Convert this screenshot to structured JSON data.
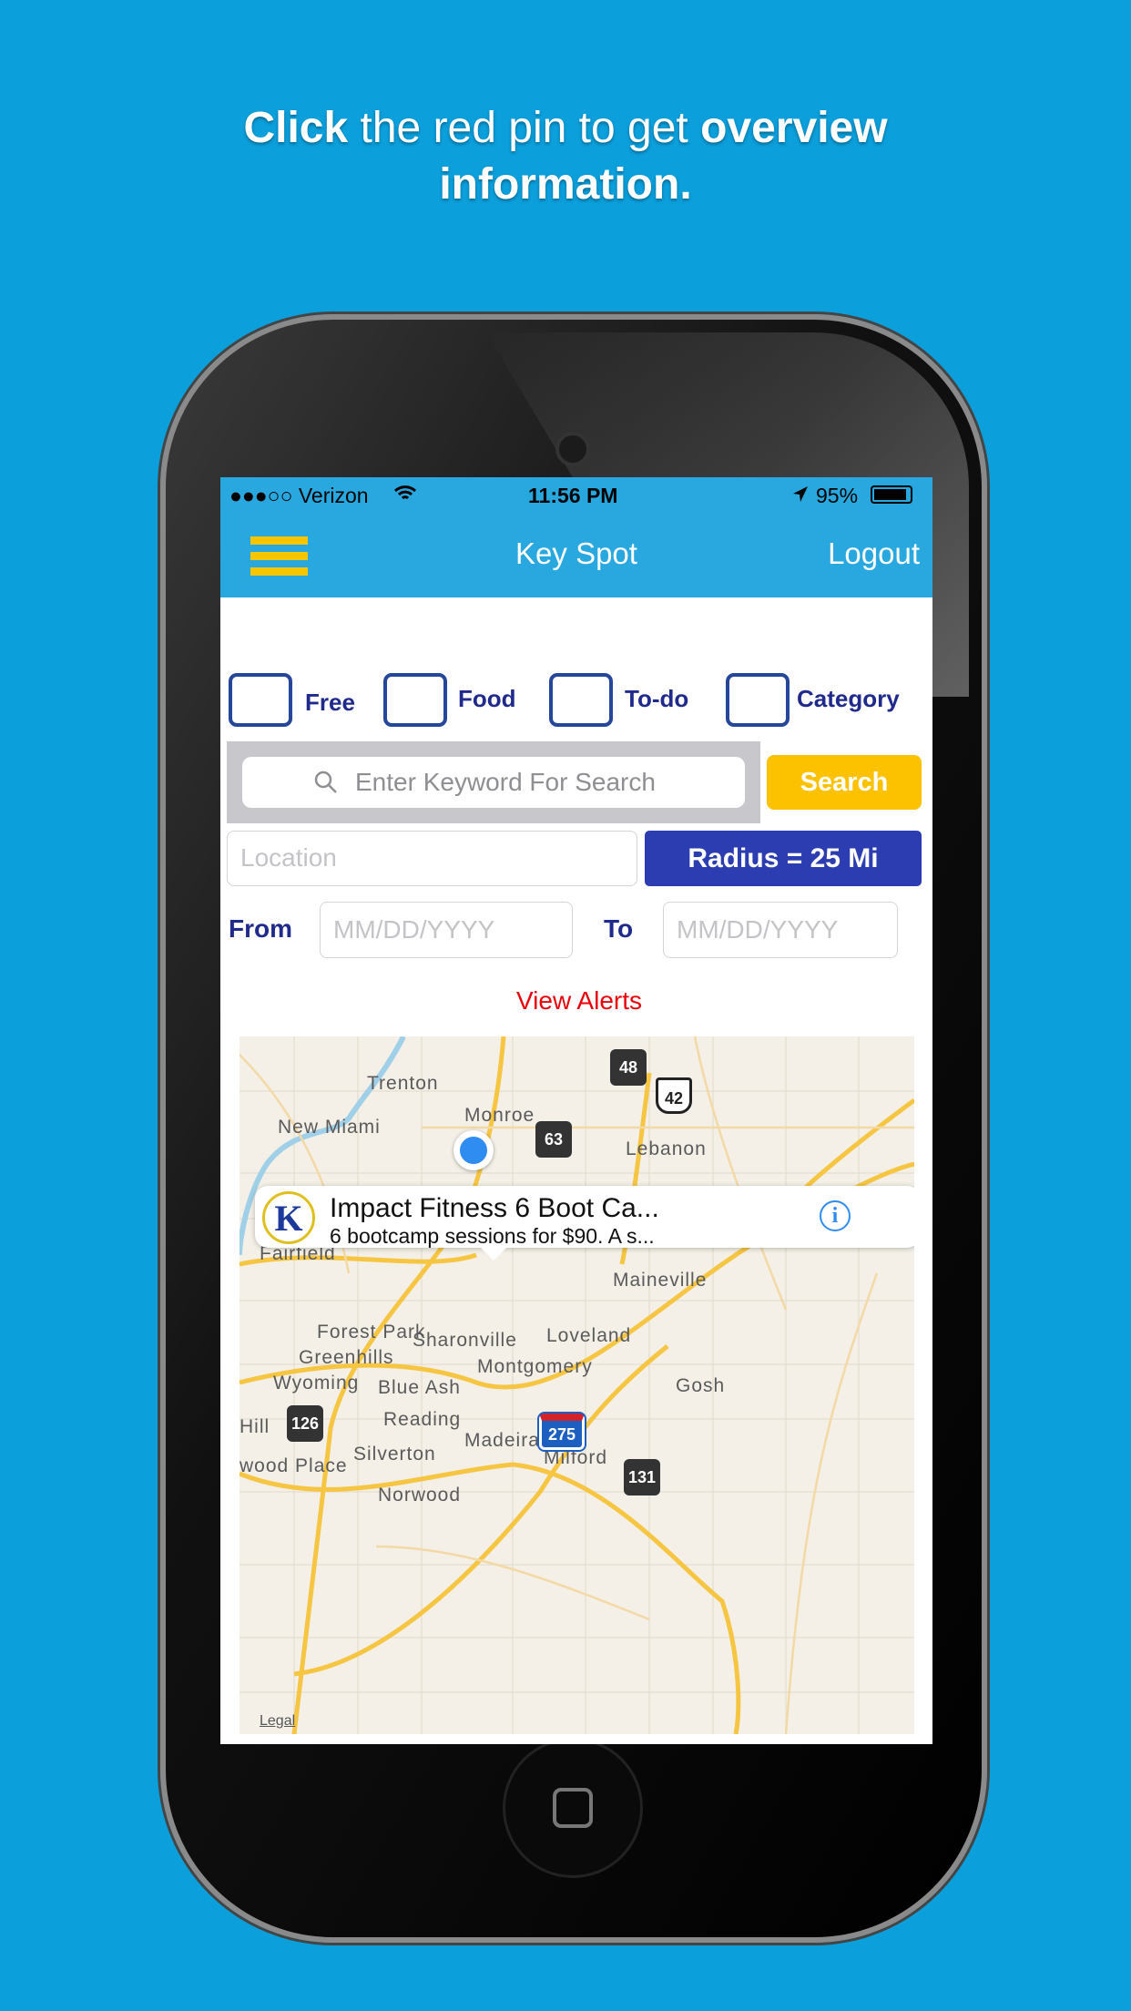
{
  "headline": {
    "bold1": "Click",
    "text1": " the red pin to get ",
    "bold2": "overview",
    "line2": "information."
  },
  "status": {
    "carrier": "●●●○○ Verizon",
    "time": "11:56 PM",
    "battery": "95%"
  },
  "nav": {
    "title": "Key Spot",
    "logout": "Logout"
  },
  "filters": [
    {
      "label": "Free",
      "checked": false
    },
    {
      "label": "Food",
      "checked": false
    },
    {
      "label": "To-do",
      "checked": false
    },
    {
      "label": "Category",
      "checked": false
    }
  ],
  "search": {
    "placeholder": "Enter Keyword For Search",
    "button": "Search"
  },
  "location": {
    "placeholder": "Location",
    "radius_button": "Radius = 25 Mi"
  },
  "dates": {
    "from_label": "From",
    "from_placeholder": "MM/DD/YYYY",
    "to_label": "To",
    "to_placeholder": "MM/DD/YYYY"
  },
  "view_alerts": "View Alerts",
  "map": {
    "places": [
      "Trenton",
      "New Miami",
      "Monroe",
      "Lebanon",
      "Fairfield",
      "Maineville",
      "Forest Park",
      "Sharonville",
      "Loveland",
      "Greenhills",
      "Montgomery",
      "Wyoming",
      "Blue Ash",
      "Reading",
      "Madeira",
      "Silverton",
      "Milford",
      "wood Place",
      "Norwood",
      "Gosh",
      "Hill"
    ],
    "shields": [
      "48",
      "42",
      "63",
      "126",
      "275",
      "131"
    ],
    "legal": "Legal",
    "callout": {
      "logo": "K",
      "title": "Impact Fitness 6 Boot Ca...",
      "subtitle": "6 bootcamp sessions for $90. A s...",
      "info": "i"
    }
  },
  "colors": {
    "nav": "#29a8e0",
    "accent_yellow": "#fcc200",
    "radius_blue": "#2b3db0",
    "label_blue": "#1f2a8c",
    "alert_red": "#e8000b"
  }
}
